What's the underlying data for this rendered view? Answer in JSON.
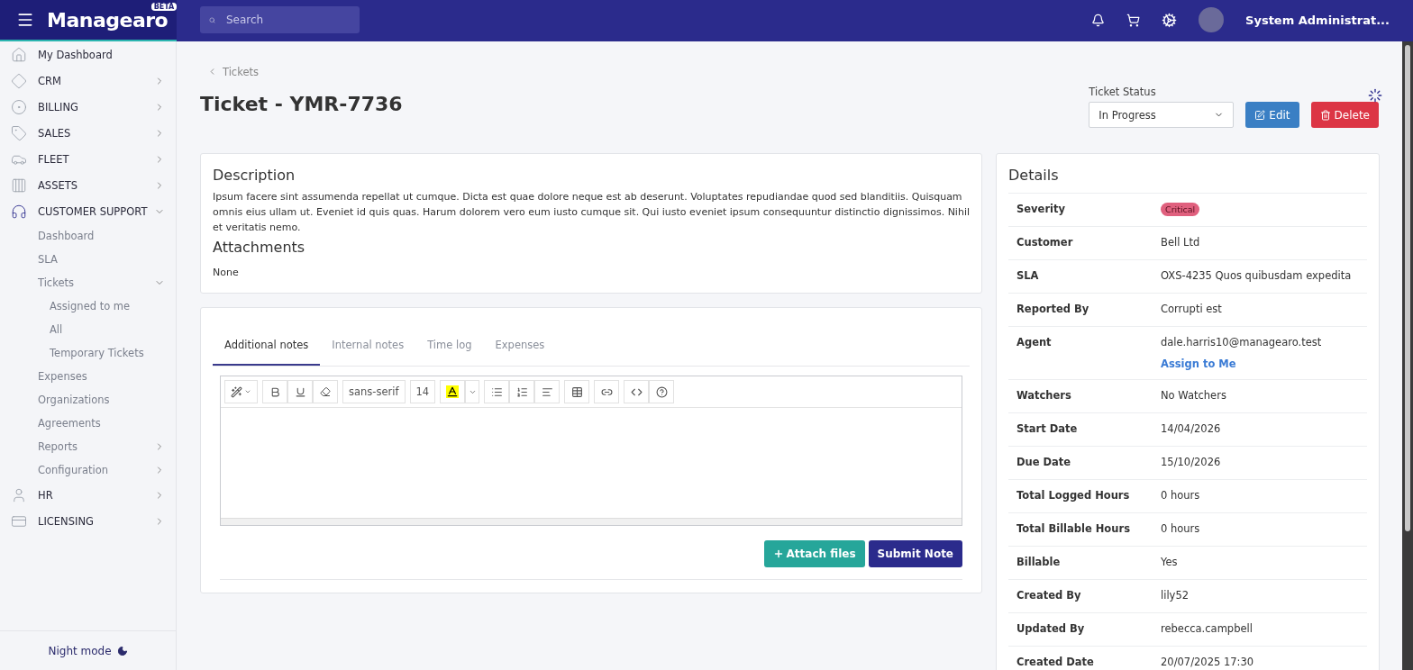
{
  "topbar": {
    "brand": "Managearo",
    "brand_badge": "BETA",
    "search": {
      "placeholder": "Search"
    },
    "user": "System Administrat..."
  },
  "sidebar": {
    "items": [
      {
        "label": "My Dashboard"
      },
      {
        "label": "CRM",
        "expanded": false
      },
      {
        "label": "BILLING",
        "expanded": false
      },
      {
        "label": "SALES",
        "expanded": false
      },
      {
        "label": "FLEET",
        "expanded": false
      },
      {
        "label": "ASSETS",
        "expanded": false
      },
      {
        "label": "CUSTOMER SUPPORT",
        "expanded": true,
        "children": [
          {
            "label": "Dashboard"
          },
          {
            "label": "SLA"
          },
          {
            "label": "Tickets",
            "expanded": true,
            "children": [
              {
                "label": "Assigned to me"
              },
              {
                "label": "All"
              },
              {
                "label": "Temporary Tickets"
              }
            ]
          },
          {
            "label": "Expenses"
          },
          {
            "label": "Organizations"
          },
          {
            "label": "Agreements"
          },
          {
            "label": "Reports",
            "expanded": false
          },
          {
            "label": "Configuration",
            "expanded": false
          }
        ]
      },
      {
        "label": "HR",
        "expanded": false
      },
      {
        "label": "LICENSING",
        "expanded": false
      }
    ],
    "night_mode": "Night mode"
  },
  "breadcrumb": "Tickets",
  "title": "Ticket - YMR-7736",
  "status": {
    "label": "Ticket Status",
    "value": "In Progress"
  },
  "actions": [
    {
      "label": "Edit",
      "kind": "edit"
    },
    {
      "label": "Delete",
      "kind": "delete"
    }
  ],
  "description": {
    "heading": "Description",
    "text": "Ipsum facere sint assumenda repellat ut cumque. Dicta est quae dolore neque est ab deserunt. Voluptates repudiandae quod sed blanditiis. Quisquam omnis eius ullam ut. Eveniet id quis quas. Harum dolorem vero eum iusto cumque sit. Qui iusto eveniet ipsum consequuntur distinctio dignissimos. Nihil et veritatis nemo.",
    "attachments_heading": "Attachments",
    "attachments": "None"
  },
  "notes": {
    "tabs": [
      {
        "label": "Additional notes",
        "selected": true
      },
      {
        "label": "Internal notes",
        "selected": false
      },
      {
        "label": "Time log",
        "selected": false
      },
      {
        "label": "Expenses",
        "selected": false
      }
    ],
    "editor": {
      "font": "sans-serif",
      "size": "14"
    },
    "buttons": [
      {
        "label": "Attach files",
        "kind": "attach"
      },
      {
        "label": "Submit Note",
        "kind": "submit"
      }
    ]
  },
  "details": {
    "heading": "Details",
    "rows": [
      {
        "label": "Severity",
        "value": "Critical",
        "kind": "badge"
      },
      {
        "label": "Customer",
        "value": "Bell Ltd",
        "kind": "text"
      },
      {
        "label": "SLA",
        "value": "OXS-4235 Quos quibusdam expedita",
        "kind": "text"
      },
      {
        "label": "Reported By",
        "value": "Corrupti est",
        "kind": "text"
      },
      {
        "label": "Agent",
        "value": "dale.harris10@managearo.test",
        "kind": "agent",
        "link": "Assign to Me"
      },
      {
        "label": "Watchers",
        "value": "No Watchers",
        "kind": "text"
      },
      {
        "label": "Start Date",
        "value": "14/04/2026",
        "kind": "text"
      },
      {
        "label": "Due Date",
        "value": "15/10/2026",
        "kind": "text"
      },
      {
        "label": "Total Logged Hours",
        "value": "0 hours",
        "kind": "text"
      },
      {
        "label": "Total Billable Hours",
        "value": "0 hours",
        "kind": "text"
      },
      {
        "label": "Billable",
        "value": "Yes",
        "kind": "text"
      },
      {
        "label": "Created By",
        "value": "lily52",
        "kind": "text"
      },
      {
        "label": "Updated By",
        "value": "rebecca.campbell",
        "kind": "text"
      },
      {
        "label": "Created Date",
        "value": "20/07/2025 17:30",
        "kind": "text"
      }
    ]
  }
}
